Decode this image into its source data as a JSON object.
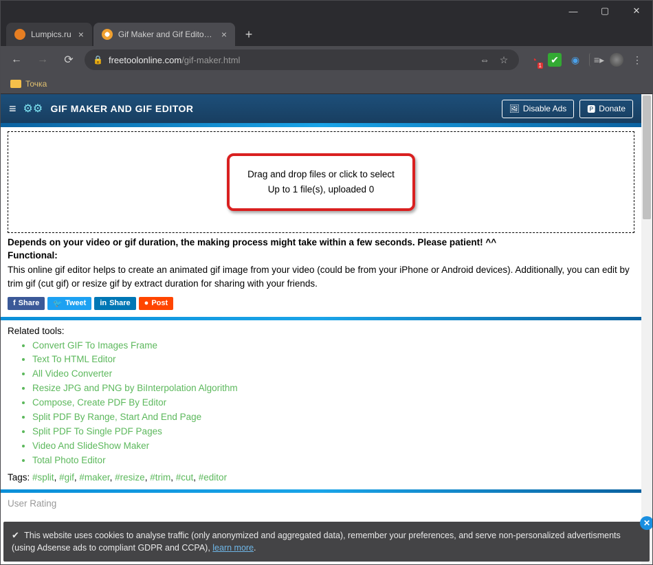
{
  "window": {
    "tabs": [
      {
        "title": "Lumpics.ru",
        "active": false
      },
      {
        "title": "Gif Maker and Gif Editor - Free To",
        "active": true
      }
    ],
    "new_tab_glyph": "+",
    "min_glyph": "—",
    "max_glyph": "▢",
    "close_glyph": "✕"
  },
  "addr": {
    "back_glyph": "←",
    "fwd_glyph": "→",
    "reload_glyph": "⟳",
    "lock_glyph": "🔒",
    "domain": "freetoolonline.com",
    "path": "/gif-maker.html",
    "translate_glyph": "⇔",
    "star_glyph": "☆",
    "menu_glyph": "⋮",
    "media_glyph": "≡▸"
  },
  "bookmarks": {
    "label": "Точка"
  },
  "navbar": {
    "menu_glyph": "≡",
    "gears_glyph": "⚙⚙",
    "title": "GIF MAKER AND GIF EDITOR",
    "disable_ads": "Disable Ads",
    "disable_ads_icon": "🖼",
    "donate": "Donate",
    "donate_icon": "🅿"
  },
  "drop": {
    "line1": "Drag and drop files or click to select",
    "line2": "Up to 1 file(s), uploaded 0"
  },
  "notice": {
    "line1": "Depends on your video or gif duration, the making process might take within a few seconds. Please patient! ^^",
    "line2_label": "Functional:"
  },
  "desc": "This online gif editor helps to create an animated gif image from your video (could be from your iPhone or Android devices). Additionally, you can edit by trim gif (cut gif) or resize gif by extract duration for sharing with your friends.",
  "share": {
    "fb": "Share",
    "tw": "Tweet",
    "in": "Share",
    "rd": "Post"
  },
  "related": {
    "title": "Related tools:",
    "items": [
      "Convert GIF To Images Frame",
      "Text To HTML Editor",
      "All Video Converter",
      "Resize JPG and PNG by BiInterpolation Algorithm",
      "Compose, Create PDF By Editor",
      "Split PDF By Range, Start And End Page",
      "Split PDF To Single PDF Pages",
      "Video And SlideShow Maker",
      "Total Photo Editor"
    ]
  },
  "tags": {
    "label": "Tags:",
    "items": [
      "#split",
      "#gif",
      "#maker",
      "#resize",
      "#trim",
      "#cut",
      "#editor"
    ]
  },
  "rating_title": "User Rating",
  "cookie": {
    "check_glyph": "✔",
    "text": "This website uses cookies to analyse traffic (only anonymized and aggregated data), remember your preferences, and serve non-personalized advertisments (using Adsense ads to compliant GDPR and CCPA), ",
    "link": "learn more",
    "tail": ".",
    "close_glyph": "✕"
  }
}
